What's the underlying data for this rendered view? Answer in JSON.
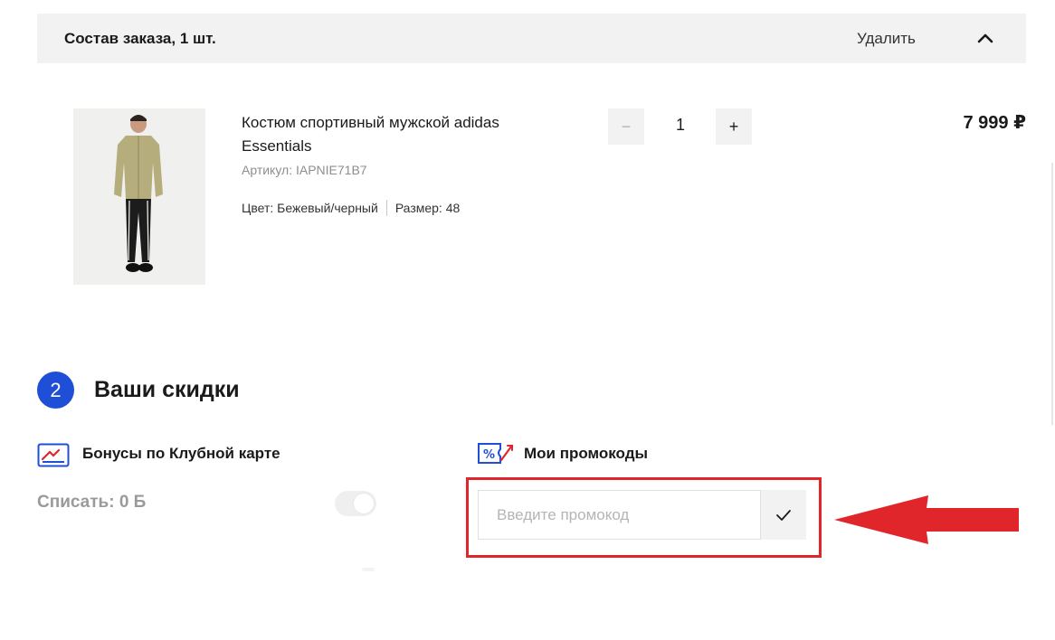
{
  "order": {
    "title": "Состав заказа, 1 шт.",
    "delete_label": "Удалить",
    "collapse_icon": "chevron-up-icon"
  },
  "product": {
    "name": "Костюм спортивный мужской adidas Essentials",
    "article": "Артикул: IAPNIE71B7",
    "color": "Цвет: Бежевый/черный",
    "size": "Размер: 48",
    "quantity": "1",
    "minus_label": "−",
    "plus_label": "+",
    "price": "7 999 ₽"
  },
  "discounts": {
    "step_number": "2",
    "title": "Ваши скидки",
    "bonus_label": "Бонусы по Клубной карте",
    "bonus_writeoff": "Списать: 0 Б",
    "bonus_toggle_on": false,
    "promo_label": "Мои промокоды",
    "promo_placeholder": "Введите промокод",
    "promo_value": ""
  },
  "colors": {
    "accent_blue": "#1f4fd6",
    "highlight_red": "#e0262b",
    "header_bg": "#f2f2f2"
  }
}
